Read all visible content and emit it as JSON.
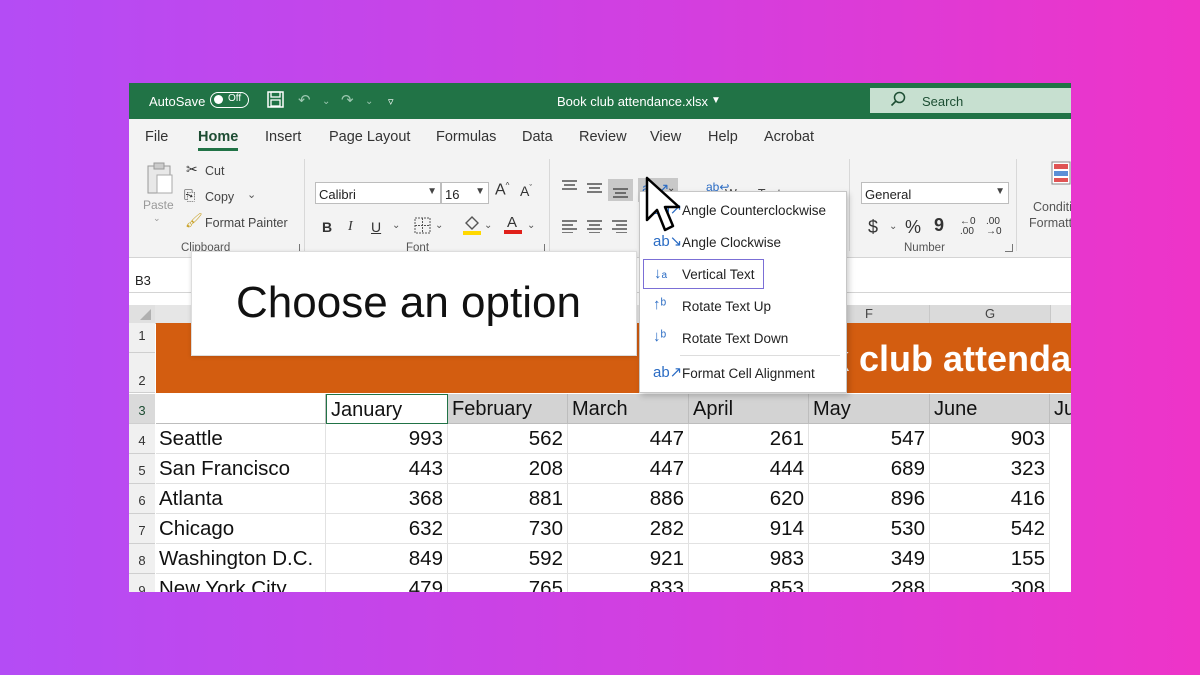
{
  "titlebar": {
    "autosave_label": "AutoSave",
    "autosave_state": "Off",
    "document_title": "Book club attendance.xlsx",
    "search_label": "Search"
  },
  "tabs": [
    "File",
    "Home",
    "Insert",
    "Page Layout",
    "Formulas",
    "Data",
    "Review",
    "View",
    "Help",
    "Acrobat"
  ],
  "ribbon": {
    "paste": "Paste",
    "cut": "Cut",
    "copy": "Copy",
    "format_painter": "Format Painter",
    "clipboard_group": "Clipboard",
    "font_name": "Calibri",
    "font_size": "16",
    "font_group": "Font",
    "bold": "B",
    "italic": "I",
    "underline": "U",
    "wrap_text": "Wrap Text",
    "number_format": "General",
    "currency": "$",
    "percent": "%",
    "comma": "9",
    "number_group": "Number",
    "conditional_formatting": "Conditi",
    "conditional_formatting_2": "Formatt"
  },
  "namebox": "B3",
  "columns": [
    "F",
    "G"
  ],
  "rows": [
    "1",
    "2",
    "3",
    "4",
    "5",
    "6",
    "7",
    "8",
    "9"
  ],
  "banner_title": "ok club attenda",
  "months": [
    "January",
    "February",
    "March",
    "April",
    "May",
    "June",
    "Ju"
  ],
  "data_rows": [
    {
      "city": "Seattle",
      "values": [
        "993",
        "562",
        "447",
        "261",
        "547",
        "903"
      ]
    },
    {
      "city": "San Francisco",
      "values": [
        "443",
        "208",
        "447",
        "444",
        "689",
        "323"
      ]
    },
    {
      "city": "Atlanta",
      "values": [
        "368",
        "881",
        "886",
        "620",
        "896",
        "416"
      ]
    },
    {
      "city": "Chicago",
      "values": [
        "632",
        "730",
        "282",
        "914",
        "530",
        "542"
      ]
    },
    {
      "city": "Washington D.C.",
      "values": [
        "849",
        "592",
        "921",
        "983",
        "349",
        "155"
      ]
    },
    {
      "city": "New York City",
      "values": [
        "479",
        "765",
        "833",
        "853",
        "288",
        "308"
      ]
    }
  ],
  "overlay_text": "Choose an option",
  "orientation_menu": {
    "items": [
      {
        "label": "Angle Counterclockwise",
        "icon": "angle-ccw-icon"
      },
      {
        "label": "Angle Clockwise",
        "icon": "angle-cw-icon"
      },
      {
        "label": "Vertical Text",
        "icon": "vertical-text-icon"
      },
      {
        "label": "Rotate Text Up",
        "icon": "rotate-up-icon"
      },
      {
        "label": "Rotate Text Down",
        "icon": "rotate-down-icon"
      },
      {
        "label": "Format Cell Alignment",
        "icon": "format-alignment-icon"
      }
    ]
  },
  "colors": {
    "excel_green": "#217346",
    "banner_orange": "#d35d10",
    "menu_selected_border": "#7b6fd6"
  }
}
